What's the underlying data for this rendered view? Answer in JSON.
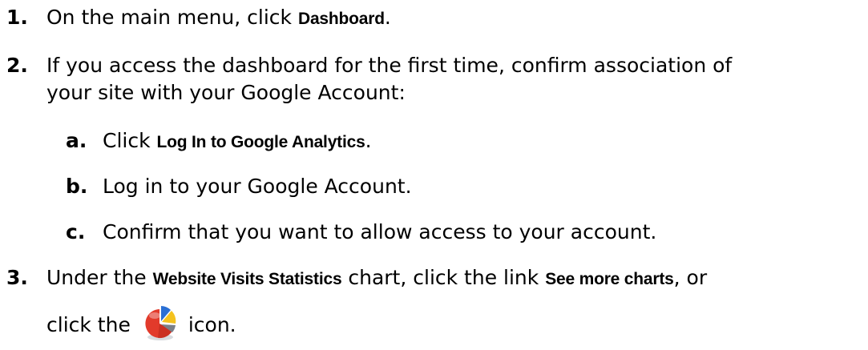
{
  "steps": [
    {
      "number": "1.",
      "before": "On the main menu, click ",
      "ui": "Dashboard",
      "after": "."
    },
    {
      "number": "2.",
      "line1": "If you access the dashboard for the first time, confirm association of",
      "line2": "your site with your Google Account:",
      "substeps": [
        {
          "letter": "a.",
          "before": "Click ",
          "ui": "Log In to Google Analytics",
          "after": "."
        },
        {
          "letter": "b.",
          "text": "Log in to your Google Account."
        },
        {
          "letter": "c.",
          "text": "Confirm that you want to allow access to your account."
        }
      ]
    },
    {
      "number": "3.",
      "line1_before": "Under the ",
      "line1_ui1": "Website Visits Statistics",
      "line1_mid": " chart, click the link ",
      "line1_ui2": "See more charts",
      "line1_after": ", or",
      "line2_before": "click the",
      "line2_after": "icon."
    }
  ],
  "icon": {
    "name": "pie-chart-icon",
    "colors": [
      "#e23a2b",
      "#2a6fd4",
      "#f4c21e",
      "#7a7f88"
    ]
  }
}
